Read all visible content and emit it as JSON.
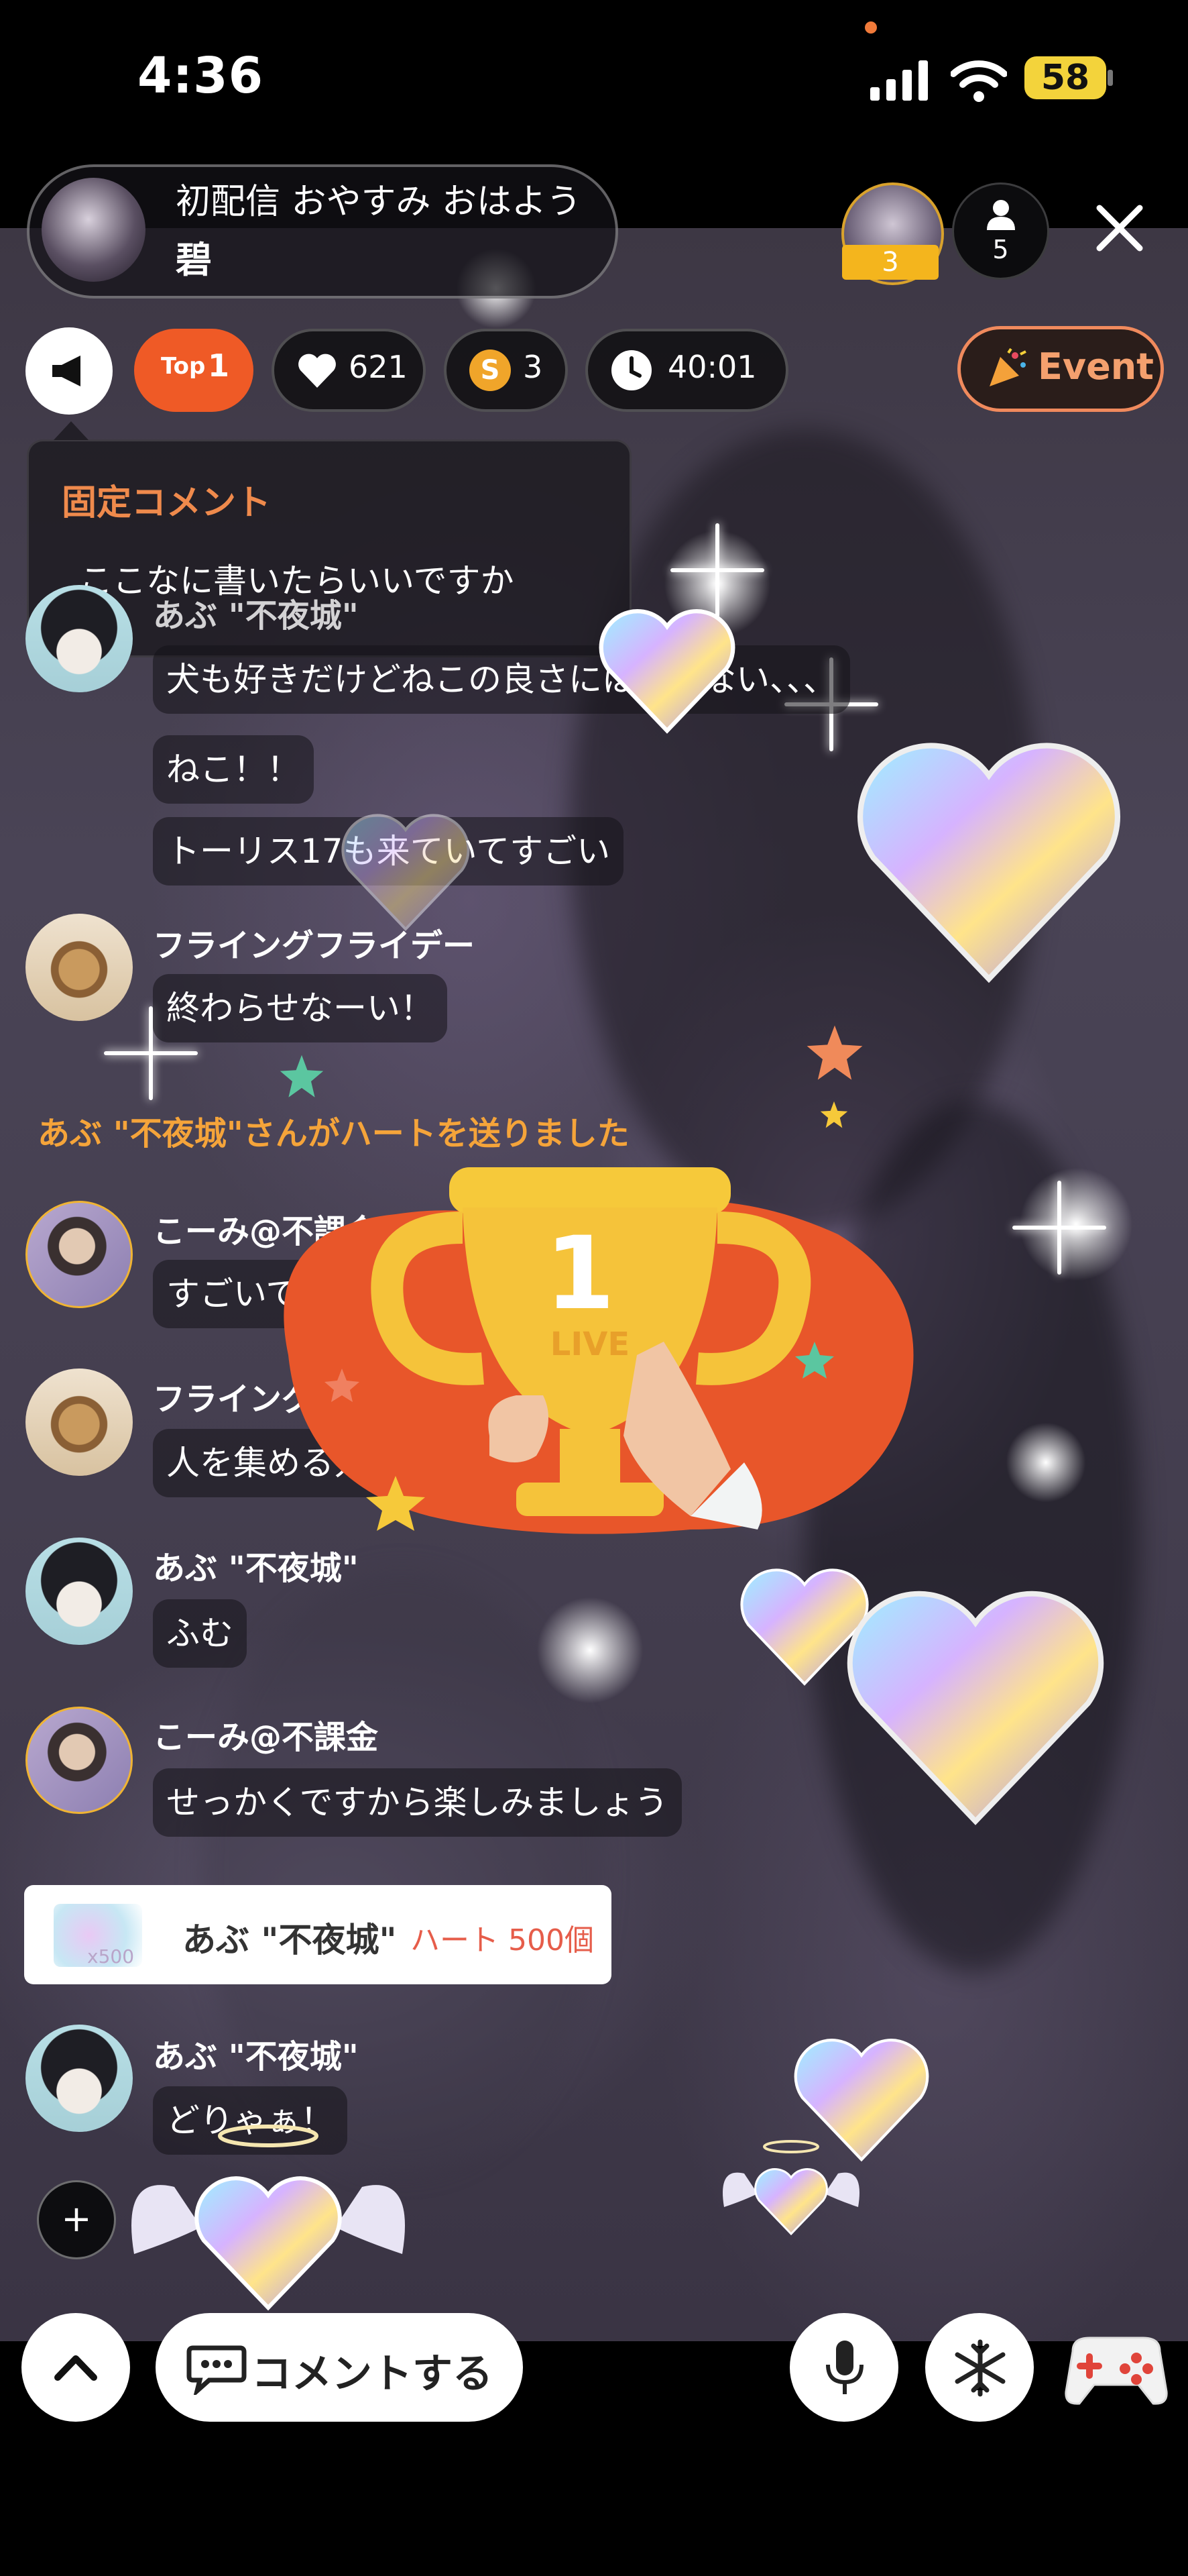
{
  "status_bar": {
    "time": "4:36",
    "battery": "58"
  },
  "header": {
    "title": "初配信 おやすみ おはよう",
    "host_name": "碧",
    "top_viewer_rank": "3",
    "viewer_count": "5"
  },
  "stats": {
    "top_label": "Top",
    "top_value": "1",
    "hearts": "621",
    "coins": "3",
    "coin_symbol": "S",
    "timer": "40:01",
    "event_label": "Event"
  },
  "pinned": {
    "title": "固定コメント",
    "text": "ここなに書いたらいいですか"
  },
  "comments": [
    {
      "user": "あぶ \"不夜城\"",
      "messages": [
        "犬も好きだけどねこの良さには敵わない、、、",
        "ねこ！！",
        "トーリス17も来ていてすごい"
      ]
    },
    {
      "user": "フライングフライデー",
      "messages": [
        "終わらせなーい！"
      ]
    },
    {
      "user": "こーみ@不課金",
      "messages": [
        "すごいですね"
      ]
    },
    {
      "user": "フライングフライデー",
      "messages": [
        "人を集める力がすごい"
      ]
    },
    {
      "user": "あぶ \"不夜城\"",
      "messages": [
        "ふむ"
      ]
    },
    {
      "user": "こーみ@不課金",
      "messages": [
        "せっかくですから楽しみましょう"
      ]
    },
    {
      "user": "あぶ \"不夜城\"",
      "messages": [
        "どりゃぁ！"
      ]
    }
  ],
  "system_message": "あぶ \"不夜城\"さんがハートを送りました",
  "gift": {
    "user": "あぶ \"不夜城\"",
    "description": "ハート 500個",
    "small_count": "x500"
  },
  "trophy": {
    "rank": "1",
    "label": "LIVE"
  },
  "bottom": {
    "comment_label": "コメントする",
    "plus": "+"
  },
  "colors": {
    "accent_orange": "#ef5a26",
    "pinned_title": "#ef8a4c",
    "system_text": "#f5a43a",
    "gift_text": "#e65d4a"
  },
  "icons": [
    "megaphone-icon",
    "heart-icon",
    "coin-icon",
    "clock-icon",
    "party-popper-icon",
    "close-icon",
    "person-icon",
    "chevron-up-icon",
    "chat-icon",
    "mic-icon",
    "snowflake-icon",
    "gamepad-icon"
  ]
}
